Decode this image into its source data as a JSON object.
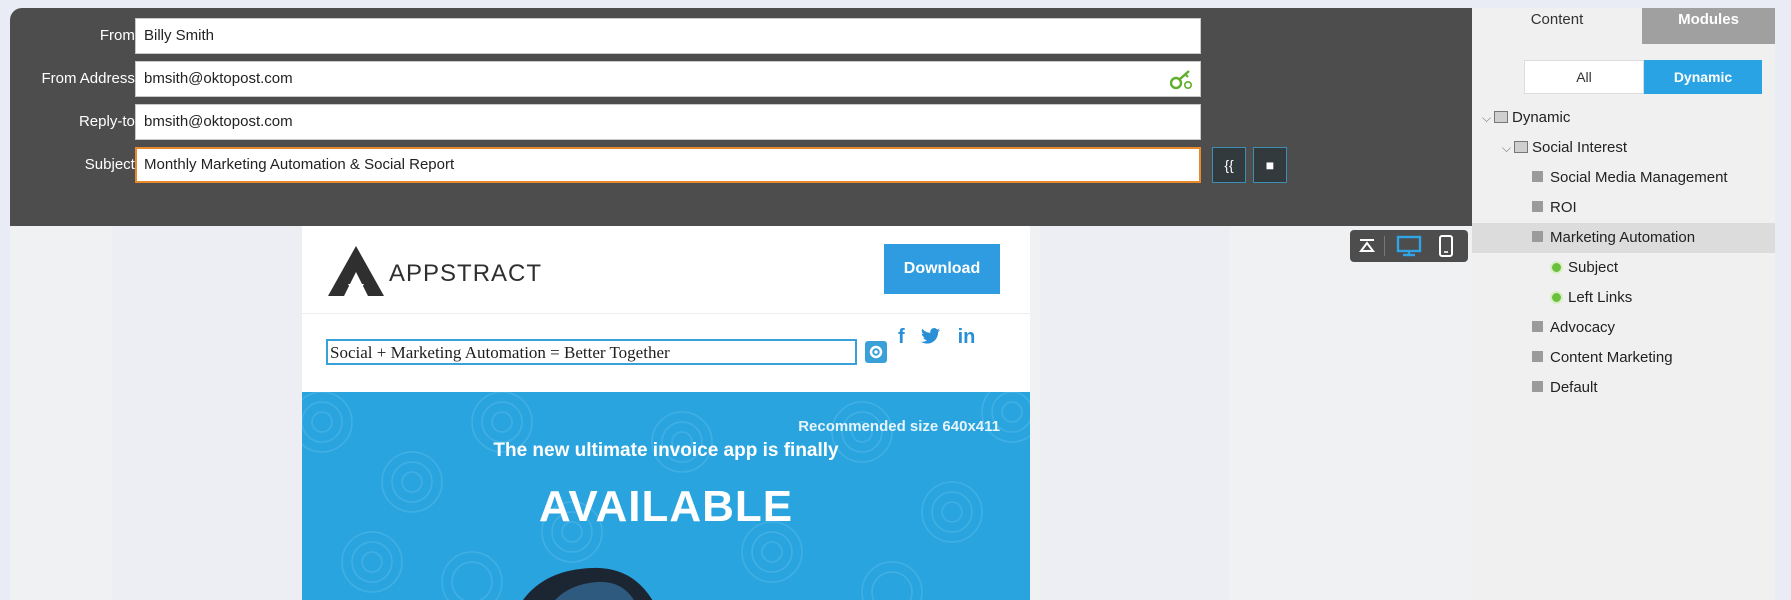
{
  "form": {
    "from_label": "From:",
    "from_value": "Billy Smith",
    "address_label": "From Address:",
    "address_value": "bmsith@oktopost.com",
    "replyto_label": "Reply-to:",
    "replyto_value": "bmsith@oktopost.com",
    "subject_label": "Subject:",
    "subject_value": "Monthly Marketing Automation & Social Report",
    "token_button": "{{",
    "stop_button": "■"
  },
  "email": {
    "brand": "APPSTRACT",
    "download": "Download",
    "social": [
      "f",
      "t",
      "in"
    ],
    "headline": "Social + Marketing Automation = Better Together",
    "hero_recommended": "Recommended size 640x411",
    "hero_line": "The new ultimate invoice app is finally",
    "hero_big": "AVAILABLE"
  },
  "panel": {
    "tabs": [
      "Content",
      "Modules"
    ],
    "filters": [
      "All",
      "Dynamic"
    ],
    "tree": [
      {
        "label": "Dynamic",
        "level": 0,
        "kind": "folder"
      },
      {
        "label": "Social Interest",
        "level": 1,
        "kind": "folder"
      },
      {
        "label": "Social Media Management",
        "level": 2,
        "kind": "item"
      },
      {
        "label": "ROI",
        "level": 2,
        "kind": "item"
      },
      {
        "label": "Marketing Automation",
        "level": 2,
        "kind": "item",
        "selected": true
      },
      {
        "label": "Subject",
        "level": 3,
        "kind": "dynamic"
      },
      {
        "label": "Left Links",
        "level": 3,
        "kind": "dynamic"
      },
      {
        "label": "Advocacy",
        "level": 2,
        "kind": "item"
      },
      {
        "label": "Content Marketing",
        "level": 2,
        "kind": "item"
      },
      {
        "label": "Default",
        "level": 2,
        "kind": "item"
      }
    ]
  },
  "colors": {
    "accent": "#29a3e3",
    "header": "#4d4d4d",
    "subject_border": "#e88a2c"
  }
}
